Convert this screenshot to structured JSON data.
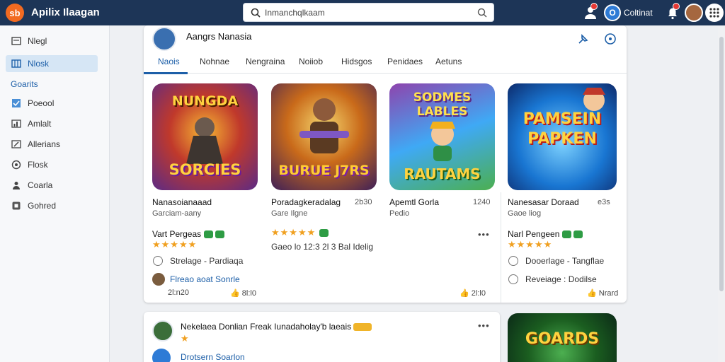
{
  "topbar": {
    "logo_text": "sb",
    "title": "Apilix Ilaagan",
    "search_text": "Inmanchqlkaam",
    "user_name": "Coltinat",
    "user_initial": "O"
  },
  "sidebar": {
    "items": [
      {
        "label": "Nlegl",
        "icon": "inbox-icon"
      },
      {
        "label": "Nlosk",
        "icon": "grid-icon",
        "active": true
      }
    ],
    "section_label": "Goarits",
    "items2": [
      {
        "label": "Poeool",
        "icon": "check-icon"
      },
      {
        "label": "Amlalt",
        "icon": "bars-icon"
      },
      {
        "label": "Allerians",
        "icon": "edit-icon"
      },
      {
        "label": "Flosk",
        "icon": "clock-icon"
      },
      {
        "label": "Coarla",
        "icon": "people-icon"
      },
      {
        "label": "Gohred",
        "icon": "box-icon"
      }
    ]
  },
  "card": {
    "title": "Aangrs Nanasia",
    "tabs": [
      "Naois",
      "Nohnae",
      "Nengraina",
      "Noiiob",
      "Hidsgos",
      "Penidaes",
      "Aetuns"
    ],
    "games": [
      {
        "art_top": "NUNGDA",
        "art_bottom": "SORCIES",
        "name": "Nanasoianaaad",
        "sub": "Garciam-aany",
        "num": "",
        "owner": "Vart Pergeas",
        "stars": "★★★★★",
        "option": "Strelage - Pardiaqa",
        "link": "Flreao aoat Sonrle",
        "date": "2l:n20",
        "likes": "8l:l0"
      },
      {
        "art_top": "",
        "art_bottom": "BURUE J7RS",
        "name": "Poradagkeradalag",
        "sub": "Gare Ilgne",
        "num": "2b30",
        "owner": "",
        "stars": "★★★★★",
        "option": "Gaeo lo 12:3 2l 3 Bal Idelig",
        "link": "",
        "date": "",
        "likes": "2l:l0"
      },
      {
        "art_top": "SODMES LABLES",
        "art_bottom": "RAUTAMS",
        "name": "Apemtl Gorla",
        "sub": "Pedio",
        "num": "1240",
        "owner": "",
        "stars": "",
        "option": "",
        "link": "",
        "date": "",
        "likes": ""
      },
      {
        "art_top": "PAMSEIN",
        "art_bottom": "PAPKEN",
        "name": "Nanesasar Doraad",
        "sub": "Gaoe liog",
        "num": "e3s",
        "owner": "Narl Pengeen",
        "stars": "★★★★★",
        "option": "Dooerlage - Tangflae",
        "link": "",
        "option2": "Reveiage : Dodilse",
        "date": "",
        "likes": "Nrard"
      }
    ],
    "more": "•••"
  },
  "card2": {
    "title": "Nekelaea Donlian Freak Iunadaholay'b laeais",
    "link": "Drotsern Soarlon",
    "more": "•••"
  },
  "card3": {
    "art_text": "GOARDS"
  },
  "colors": {
    "topbar": "#1d3557",
    "accent": "#1d5fa8",
    "stars": "#f0a020",
    "green": "#2e9c44"
  }
}
